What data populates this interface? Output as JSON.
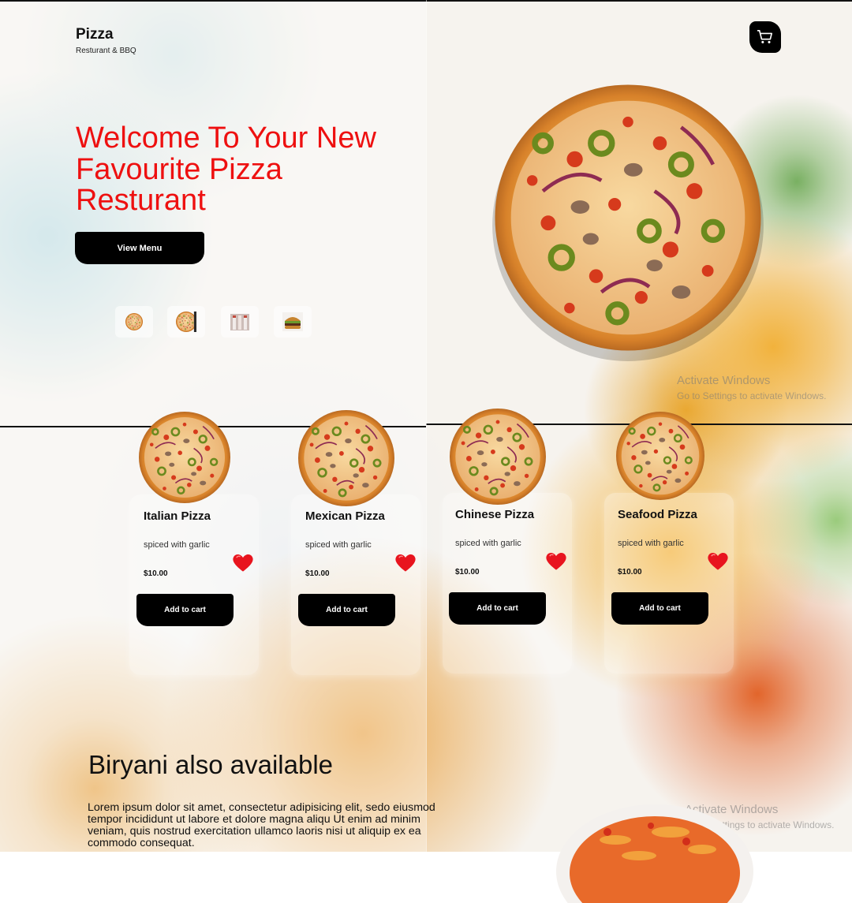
{
  "brand": {
    "title": "Pizza",
    "subtitle": "Resturant & BBQ"
  },
  "header": {
    "cart_icon": "cart-icon"
  },
  "hero": {
    "title": "Welcome To Your New Favourite Pizza Resturant",
    "button_label": "View Menu",
    "thumbnails": [
      {
        "icon": "pizza-thumb-icon"
      },
      {
        "icon": "pizza-slice-thumb-icon"
      },
      {
        "icon": "drinks-thumb-icon"
      },
      {
        "icon": "burger-thumb-icon"
      }
    ]
  },
  "watermark": {
    "title": "Activate Windows",
    "subtitle": "Go to Settings to activate Windows."
  },
  "menu": {
    "items": [
      {
        "name": "Italian Pizza",
        "description": "spiced with garlic",
        "price": "$10.00",
        "button": "Add to cart"
      },
      {
        "name": "Mexican Pizza",
        "description": "spiced with garlic",
        "price": "$10.00",
        "button": "Add to cart"
      },
      {
        "name": "Chinese Pizza",
        "description": "spiced with garlic",
        "price": "$10.00",
        "button": "Add to cart"
      },
      {
        "name": "Seafood Pizza",
        "description": "spiced with garlic",
        "price": "$10.00",
        "button": "Add to cart"
      }
    ]
  },
  "biryani": {
    "title": "Biryani also available",
    "text": "Lorem ipsum dolor sit amet, consectetur adipisicing elit, sedo eiusmod tempor incididunt ut labore et dolore magna aliqu Ut enim ad minim veniam, quis nostrud exercitation ullamco laoris nisi ut aliquip ex ea commodo consequat."
  },
  "colors": {
    "accent": "#ee1010",
    "button": "#000000",
    "heart": "#e8141e"
  }
}
